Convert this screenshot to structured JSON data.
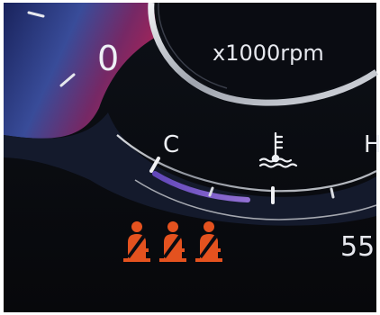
{
  "tachometer": {
    "zero_label": "0",
    "rpm_label": "x1000rpm"
  },
  "temperature_gauge": {
    "cold_label": "C",
    "hot_label": "H",
    "icon": "coolant-temperature-icon"
  },
  "seatbelt_warnings": {
    "icon": "seatbelt-warning-icon",
    "count": 3,
    "color": "#e4521f"
  },
  "odometer_fragment": {
    "value": "55"
  },
  "colors": {
    "dial_blue": "#3b4fa0",
    "dial_magenta": "#b2245a",
    "cold_zone_purple": "#8a5cd6",
    "chrome_ring": "#c9ccd2",
    "warning_orange": "#e4521f"
  }
}
